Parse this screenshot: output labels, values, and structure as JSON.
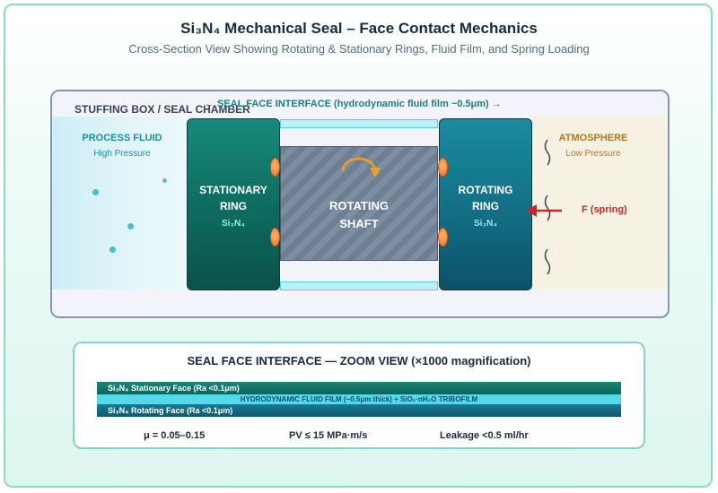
{
  "header": {
    "title": "Si₃N₄ Mechanical Seal –  Face Contact Mechanics",
    "subtitle": "Cross-Section View Showing Rotating & Stationary Rings, Fluid Film, and Spring Loading"
  },
  "chamber": {
    "label": "STUFFING BOX / SEAL CHAMBER",
    "interface_label": "← SEAL FACE INTERFACE (hydrodynamic fluid film ~0.5μm) →"
  },
  "process_side": {
    "title": "PROCESS FLUID",
    "subtitle": "High Pressure",
    "color": "#1a8fa5"
  },
  "atmosphere_side": {
    "title": "ATMOSPHERE",
    "subtitle": "Low Pressure",
    "color": "#b8761a"
  },
  "stationary_ring": {
    "line1": "STATIONARY",
    "line2": "RING",
    "material": "Si₃N₄",
    "color": "#0f6a5f"
  },
  "rotating_ring": {
    "line1": "ROTATING",
    "line2": "RING",
    "material": "Si₃N₄",
    "color": "#136e85"
  },
  "shaft": {
    "line1": "ROTATING",
    "line2": "SHAFT",
    "rotation_icon": "rotation-arrow-icon"
  },
  "spring": {
    "label": "F (spring)",
    "color": "#c62828"
  },
  "zoom": {
    "title": "SEAL FACE INTERFACE — ZOOM VIEW (×1000 magnification)",
    "layers": {
      "stationary_face": "Si₃N₄ Stationary Face (Ra <0.1μm)",
      "fluid_film": "HYDRODYNAMIC FLUID FILM (~0.5μm thick) + SiO₂·nH₂O TRIBOFILM",
      "rotating_face": "Si₃N₄ Rotating Face (Ra <0.1μm)"
    },
    "metrics": {
      "friction": "μ = 0.05–0.15",
      "pv": "PV ≤ 15 MPa·m/s",
      "leakage": "Leakage <0.5 ml/hr"
    }
  }
}
